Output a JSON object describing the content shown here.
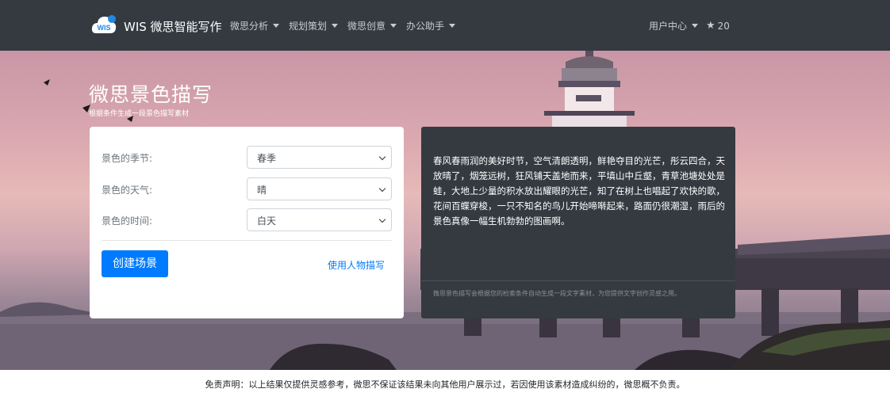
{
  "navbar": {
    "brand": "WIS 微思智能写作",
    "logo_icon": "cloud-logo-icon",
    "logo_text": "WIS",
    "menu": [
      {
        "label": "微思分析"
      },
      {
        "label": "规划策划"
      },
      {
        "label": "微思创意"
      },
      {
        "label": "办公助手"
      }
    ],
    "user_center": "用户中心",
    "star_icon": "star-icon",
    "star_count": "20"
  },
  "hero": {
    "title": "微思景色描写",
    "subtitle": "根据条件生成一段景色描写素材"
  },
  "form": {
    "season_label": "景色的季节:",
    "season_value": "春季",
    "weather_label": "景色的天气:",
    "weather_value": "晴",
    "time_label": "景色的时间:",
    "time_value": "白天",
    "create_button": "创建场景",
    "person_link": "使用人物描写"
  },
  "output": {
    "text": "春风春雨润的美好时节，空气清朗透明，鲜艳夺目的光芒，彤云四合，天放晴了，烟笼远树，狂风铺天盖地而来，平填山中丘壑，青草池塘处处是蛙，大地上少量的积水放出耀眼的光芒，知了在树上也唱起了欢快的歌，花间百蝶穿梭，一只不知名的鸟儿开始啼啭起来，路面仍很潮湿，雨后的景色真像一幅生机勃勃的图画啊。",
    "note": "微思景色描写会根据您的检索条件自动生成一段文字素材，为您提供文字创作灵感之用。"
  },
  "footer": {
    "disclaimer": "免责声明：以上结果仅提供灵感参考，微思不保证该结果未向其他用户展示过，若因使用该素材造成纠纷的，微思概不负责。"
  },
  "colors": {
    "navbar_bg": "#343a40",
    "primary": "#007bff",
    "output_bg": "#343a40"
  }
}
